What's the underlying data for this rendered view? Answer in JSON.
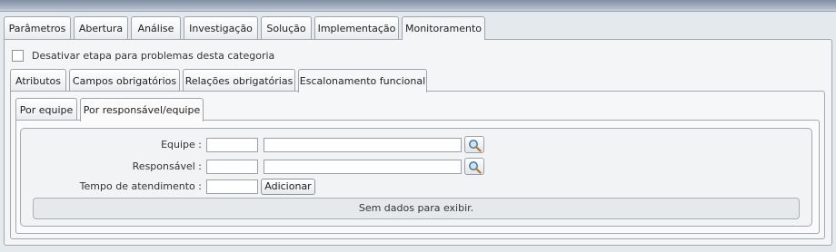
{
  "main_tabs": [
    {
      "label": "Parâmetros"
    },
    {
      "label": "Abertura"
    },
    {
      "label": "Análise"
    },
    {
      "label": "Investigação"
    },
    {
      "label": "Solução"
    },
    {
      "label": "Implementação"
    },
    {
      "label": "Monitoramento"
    }
  ],
  "main_tabs_active": "Monitoramento",
  "disable_step": {
    "label": "Desativar etapa para problemas desta categoria",
    "checked": false
  },
  "sub_tabs": [
    {
      "label": "Atributos"
    },
    {
      "label": "Campos obrigatórios"
    },
    {
      "label": "Relações obrigatórias"
    },
    {
      "label": "Escalonamento funcional"
    }
  ],
  "sub_tabs_active": "Escalonamento funcional",
  "inner_tabs": [
    {
      "label": "Por equipe"
    },
    {
      "label": "Por responsável/equipe"
    }
  ],
  "inner_tabs_active": "Por responsável/equipe",
  "form": {
    "team_label": "Equipe :",
    "responsible_label": "Responsável :",
    "time_label": "Tempo de atendimento :",
    "add_button": "Adicionar",
    "team_code": "",
    "team_name": "",
    "responsible_code": "",
    "responsible_name": "",
    "time_value": ""
  },
  "empty_message": "Sem dados para exibir.",
  "icons": {
    "search": "magnifier-icon"
  },
  "colors": {
    "panel_bg": "#f3f5f7",
    "border": "#a2a8ae",
    "topbar": "#8d9caf"
  }
}
